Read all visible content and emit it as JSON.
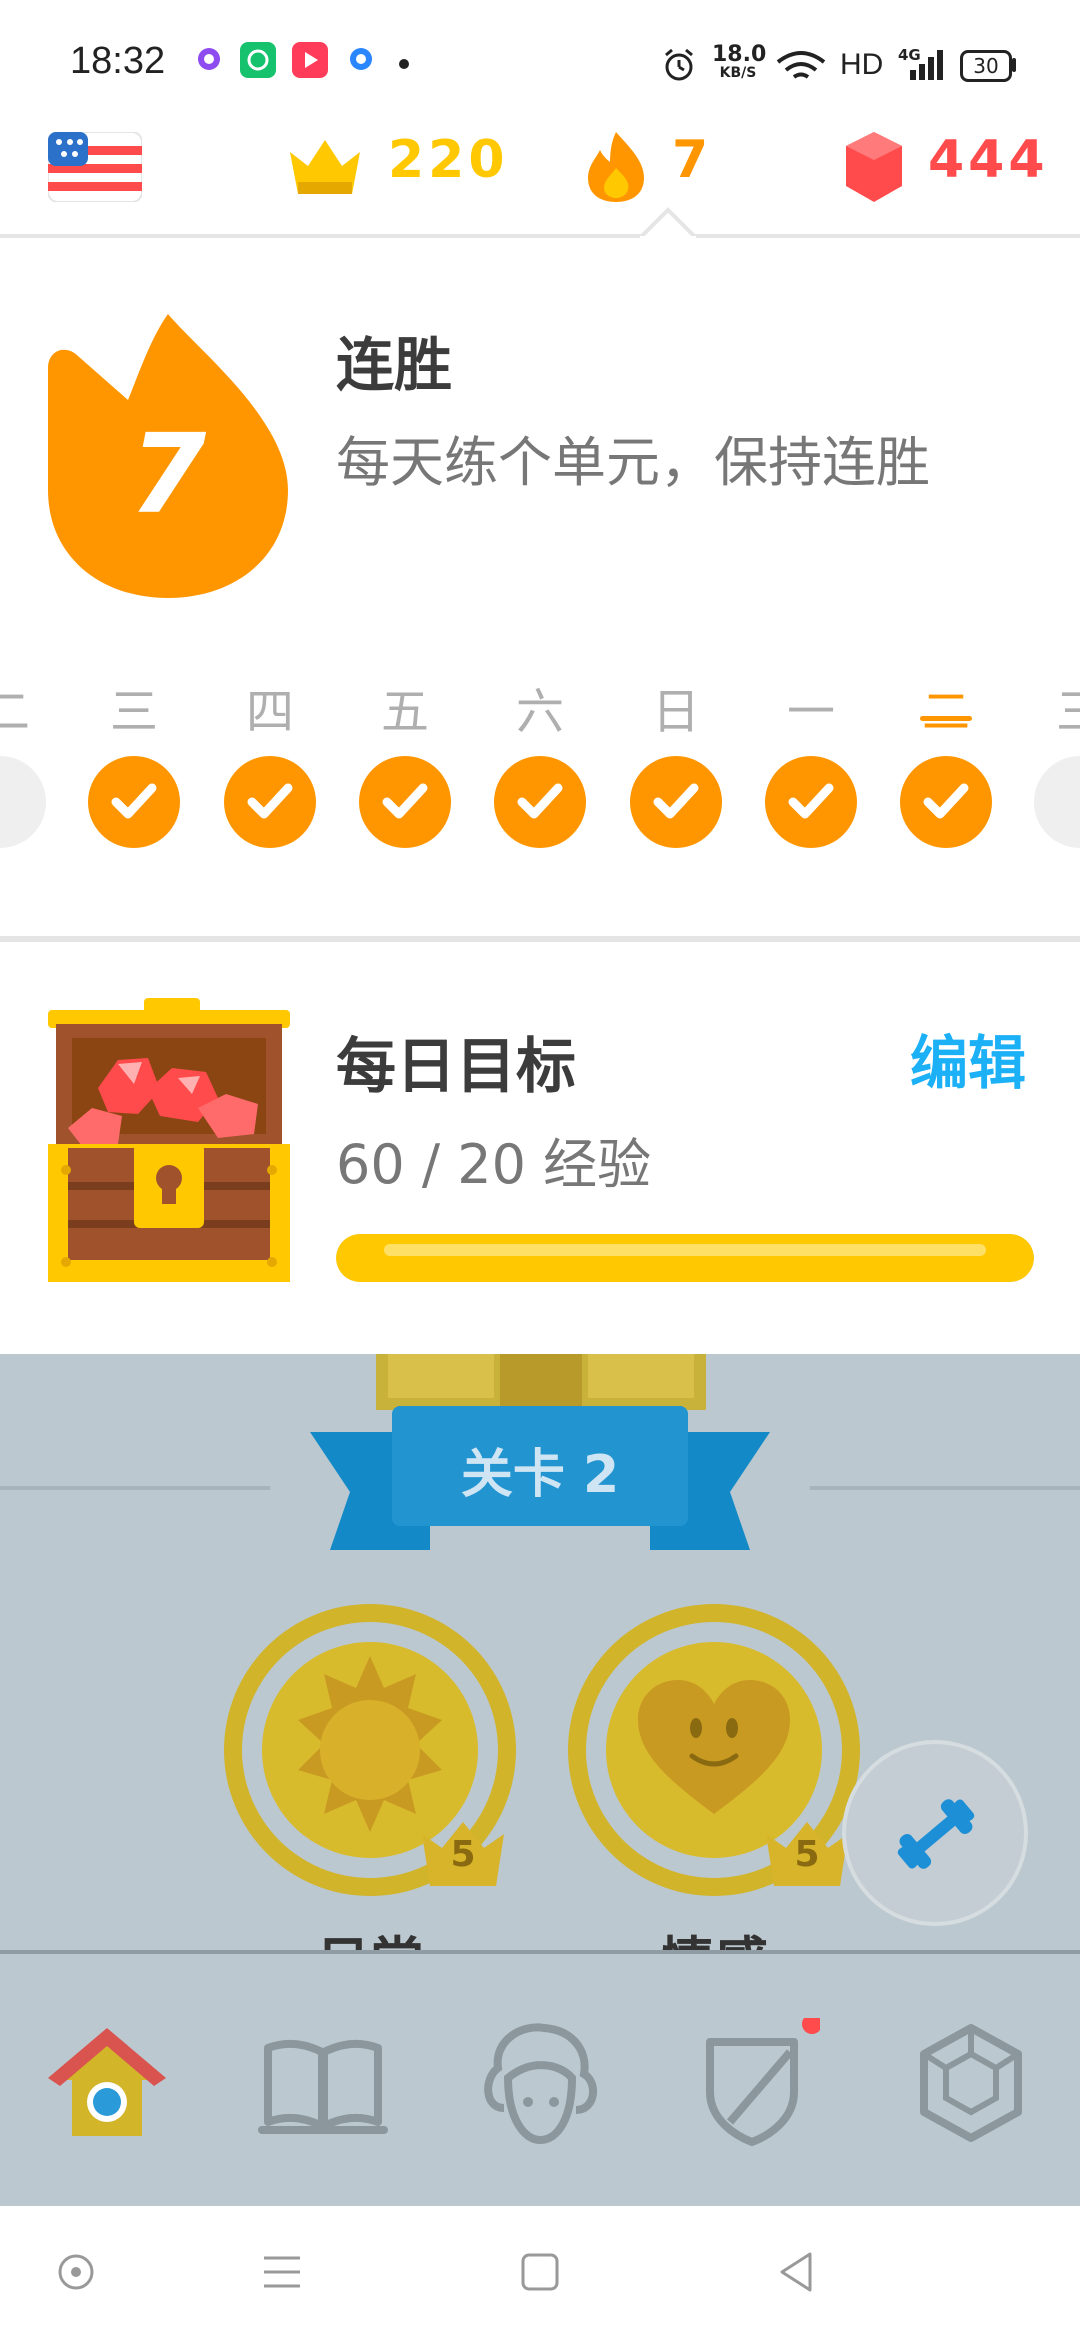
{
  "status_bar": {
    "time": "18:32",
    "net_speed": "18.0",
    "net_unit": "KB/S",
    "hd_label": "HD",
    "network_type": "4G",
    "battery": "30"
  },
  "top_stats": {
    "crowns": "220",
    "streak": "7",
    "gems": "444",
    "flag_icon": "us-flag-icon"
  },
  "streak_panel": {
    "count": "7",
    "title": "连胜",
    "subtitle": "每天练个单元，保持连胜",
    "days": [
      {
        "label": "二",
        "state": "partial"
      },
      {
        "label": "三",
        "state": "done"
      },
      {
        "label": "四",
        "state": "done"
      },
      {
        "label": "五",
        "state": "done"
      },
      {
        "label": "六",
        "state": "done"
      },
      {
        "label": "日",
        "state": "done"
      },
      {
        "label": "一",
        "state": "done"
      },
      {
        "label": "二",
        "state": "today"
      },
      {
        "label": "三",
        "state": "partial"
      }
    ]
  },
  "daily_goal": {
    "title": "每日目标",
    "edit_label": "编辑",
    "progress_text": "60 / 20 经验",
    "progress_fraction": 1.0
  },
  "map": {
    "level_label": "关卡 2",
    "skills": [
      {
        "name": "日常",
        "crown_level": "5",
        "icon": "sun-icon"
      },
      {
        "name": "情感",
        "crown_level": "5",
        "icon": "heart-face-icon"
      }
    ]
  },
  "bottom_nav": [
    "home-icon",
    "stories-icon",
    "profile-icon",
    "leagues-shield-icon",
    "shop-icon"
  ],
  "colors": {
    "orange": "#ff9600",
    "blue": "#1cb0f6",
    "gold": "#ffc800",
    "red": "#ff4b4b",
    "map_bg": "#bbc8cf"
  }
}
